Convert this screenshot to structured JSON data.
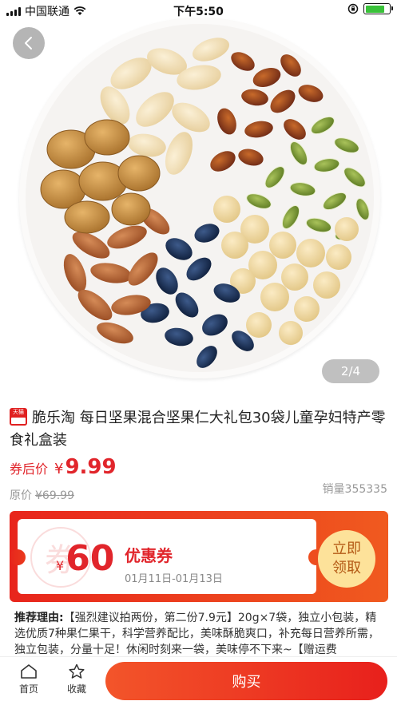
{
  "status_bar": {
    "carrier": "中国联通",
    "time": "下午5:50",
    "battery_color": "#3ac23a"
  },
  "hero": {
    "image_counter": "2/4",
    "back_icon": "chevron-left-icon"
  },
  "product": {
    "shop_badge_text": "天猫",
    "title": "脆乐淘 每日坚果混合坚果仁大礼包30袋儿童孕妇特产零食礼盒装",
    "coupon_price_label": "券后价",
    "currency": "¥",
    "coupon_price": "9.99",
    "original_price_label": "原价",
    "original_price": "¥69.99",
    "sales": "销量355335"
  },
  "coupon": {
    "stamp_text": "券",
    "currency": "¥",
    "amount": "60",
    "title": "优惠券",
    "date_range": "01月11日-01月13日",
    "claim_line1": "立即",
    "claim_line2": "领取",
    "accent_color": "#e1252b"
  },
  "recommend": {
    "label": "推荐理由:",
    "text": "【强烈建议拍两份，第二份7.9元】20g×7袋，独立小包装，精选优质7种果仁果干，科学营养配比，美味酥脆爽口，补充每日营养所需，独立包装，分量十足！休闲时刻来一袋，美味停不下来~【赠运费"
  },
  "bottom_bar": {
    "home_label": "首页",
    "favorite_label": "收藏",
    "buy_label": "购买"
  }
}
